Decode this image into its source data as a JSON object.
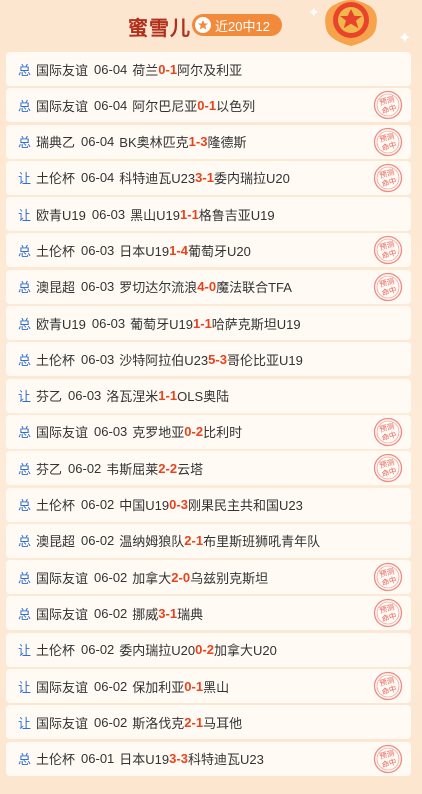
{
  "header": {
    "title": "蜜雪儿",
    "record": "近20中12"
  },
  "stamp_text": [
    "预测",
    "命中"
  ],
  "colors": {
    "accent": "#e8431c",
    "link": "#2f6fd1",
    "title": "#b0301c",
    "pill": "#f28a3c"
  },
  "matches": [
    {
      "type": "总",
      "league": "国际友谊",
      "date": "06-04",
      "home": "荷兰",
      "hs": "0",
      "as": "1",
      "away": "阿尔及利亚",
      "hit": false
    },
    {
      "type": "总",
      "league": "国际友谊",
      "date": "06-04",
      "home": "阿尔巴尼亚",
      "hs": "0",
      "as": "1",
      "away": "以色列",
      "hit": true
    },
    {
      "type": "总",
      "league": "瑞典乙",
      "date": "06-04",
      "home": "BK奥林匹克",
      "hs": "1",
      "as": "3",
      "away": "隆德斯",
      "hit": true
    },
    {
      "type": "让",
      "league": "土伦杯",
      "date": "06-04",
      "home": "科特迪瓦U23",
      "hs": "3",
      "as": "1",
      "away": "委内瑞拉U20",
      "hit": true
    },
    {
      "type": "让",
      "league": "欧青U19",
      "date": "06-03",
      "home": "黑山U19",
      "hs": "1",
      "as": "1",
      "away": "格鲁吉亚U19",
      "hit": false
    },
    {
      "type": "总",
      "league": "土伦杯",
      "date": "06-03",
      "home": "日本U19",
      "hs": "1",
      "as": "4",
      "away": "葡萄牙U20",
      "hit": true
    },
    {
      "type": "总",
      "league": "澳昆超",
      "date": "06-03",
      "home": "罗切达尔流浪",
      "hs": "4",
      "as": "0",
      "away": "魔法联合TFA",
      "hit": true
    },
    {
      "type": "总",
      "league": "欧青U19",
      "date": "06-03",
      "home": "葡萄牙U19",
      "hs": "1",
      "as": "1",
      "away": "哈萨克斯坦U19",
      "hit": false
    },
    {
      "type": "总",
      "league": "土伦杯",
      "date": "06-03",
      "home": "沙特阿拉伯U23",
      "hs": "5",
      "as": "3",
      "away": "哥伦比亚U19",
      "hit": false
    },
    {
      "type": "让",
      "league": "芬乙",
      "date": "06-03",
      "home": "洛瓦涅米",
      "hs": "1",
      "as": "1",
      "away": "OLS奥陆",
      "hit": false
    },
    {
      "type": "总",
      "league": "国际友谊",
      "date": "06-03",
      "home": "克罗地亚",
      "hs": "0",
      "as": "2",
      "away": "比利时",
      "hit": true
    },
    {
      "type": "总",
      "league": "芬乙",
      "date": "06-02",
      "home": "韦斯屈莱",
      "hs": "2",
      "as": "2",
      "away": "云塔",
      "hit": true
    },
    {
      "type": "总",
      "league": "土伦杯",
      "date": "06-02",
      "home": "中国U19",
      "hs": "0",
      "as": "3",
      "away": "刚果民主共和国U23",
      "hit": false
    },
    {
      "type": "总",
      "league": "澳昆超",
      "date": "06-02",
      "home": "温纳姆狼队",
      "hs": "2",
      "as": "1",
      "away": "布里斯班狮吼青年队",
      "hit": false
    },
    {
      "type": "总",
      "league": "国际友谊",
      "date": "06-02",
      "home": "加拿大",
      "hs": "2",
      "as": "0",
      "away": "乌兹别克斯坦",
      "hit": true
    },
    {
      "type": "总",
      "league": "国际友谊",
      "date": "06-02",
      "home": "挪威",
      "hs": "3",
      "as": "1",
      "away": "瑞典",
      "hit": true
    },
    {
      "type": "让",
      "league": "土伦杯",
      "date": "06-02",
      "home": "委内瑞拉U20",
      "hs": "0",
      "as": "2",
      "away": "加拿大U20",
      "hit": false
    },
    {
      "type": "让",
      "league": "国际友谊",
      "date": "06-02",
      "home": "保加利亚",
      "hs": "0",
      "as": "1",
      "away": "黑山",
      "hit": true
    },
    {
      "type": "让",
      "league": "国际友谊",
      "date": "06-02",
      "home": "斯洛伐克",
      "hs": "2",
      "as": "1",
      "away": "马耳他",
      "hit": false
    },
    {
      "type": "总",
      "league": "土伦杯",
      "date": "06-01",
      "home": "日本U19",
      "hs": "3",
      "as": "3",
      "away": "科特迪瓦U23",
      "hit": true
    }
  ]
}
